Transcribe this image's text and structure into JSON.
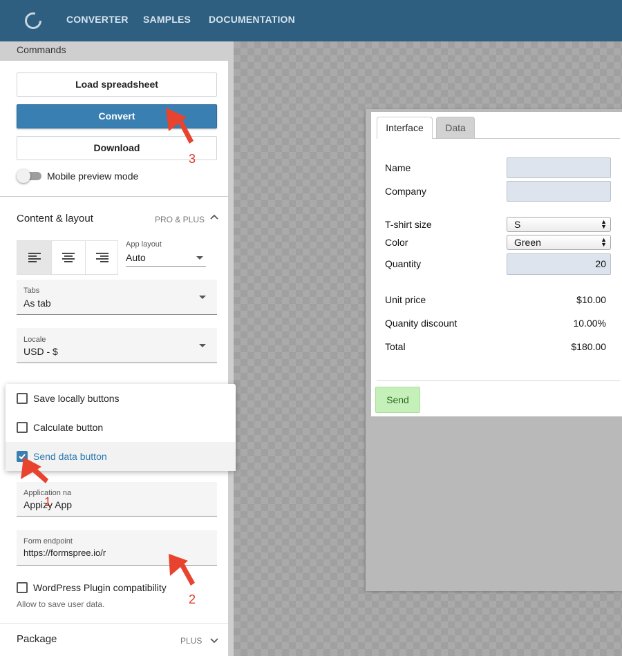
{
  "nav": {
    "links": [
      "CONVERTER",
      "SAMPLES",
      "DOCUMENTATION"
    ]
  },
  "sidebar": {
    "commands_header": "Commands",
    "buttons": {
      "load": "Load spreadsheet",
      "convert": "Convert",
      "download": "Download"
    },
    "mobile_toggle": {
      "label": "Mobile preview mode",
      "on": false
    },
    "content_layout": {
      "title": "Content & layout",
      "tag": "PRO & PLUS",
      "app_layout": {
        "label": "App layout",
        "value": "Auto"
      },
      "tabs": {
        "label": "Tabs",
        "value": "As tab"
      },
      "locale": {
        "label": "Locale",
        "value": "USD - $"
      },
      "application_name": {
        "label": "Application na",
        "value": "Appizy App"
      },
      "form_endpoint": {
        "label": "Form endpoint",
        "value": "https://formspree.io/r"
      },
      "wordpress": {
        "label": "WordPress Plugin compatibility",
        "help": "Allow to save user data.",
        "checked": false
      }
    },
    "package": {
      "title": "Package",
      "tag": "PLUS"
    }
  },
  "menu": {
    "items": [
      {
        "label": "Save locally buttons",
        "checked": false
      },
      {
        "label": "Calculate button",
        "checked": false
      },
      {
        "label": "Send data button",
        "checked": true
      }
    ]
  },
  "preview": {
    "tabs": [
      "Interface",
      "Data"
    ],
    "fields": {
      "name": {
        "label": "Name",
        "value": ""
      },
      "company": {
        "label": "Company",
        "value": ""
      },
      "tshirt_size": {
        "label": "T-shirt size",
        "value": "S"
      },
      "color": {
        "label": "Color",
        "value": "Green"
      },
      "quantity": {
        "label": "Quantity",
        "value": "20"
      }
    },
    "results": {
      "unit_price": {
        "label": "Unit price",
        "value": "$10.00"
      },
      "discount": {
        "label": "Quanity discount",
        "value": "10.00%"
      },
      "total": {
        "label": "Total",
        "value": "$180.00"
      }
    },
    "send_label": "Send"
  },
  "annotations": [
    "1",
    "2",
    "3"
  ],
  "colors": {
    "nav_bg": "#2e5f80",
    "primary": "#3a7fb2",
    "arrow": "#e8432e",
    "send_bg": "#c6f0b9",
    "input_bg": "#dde4ee"
  }
}
